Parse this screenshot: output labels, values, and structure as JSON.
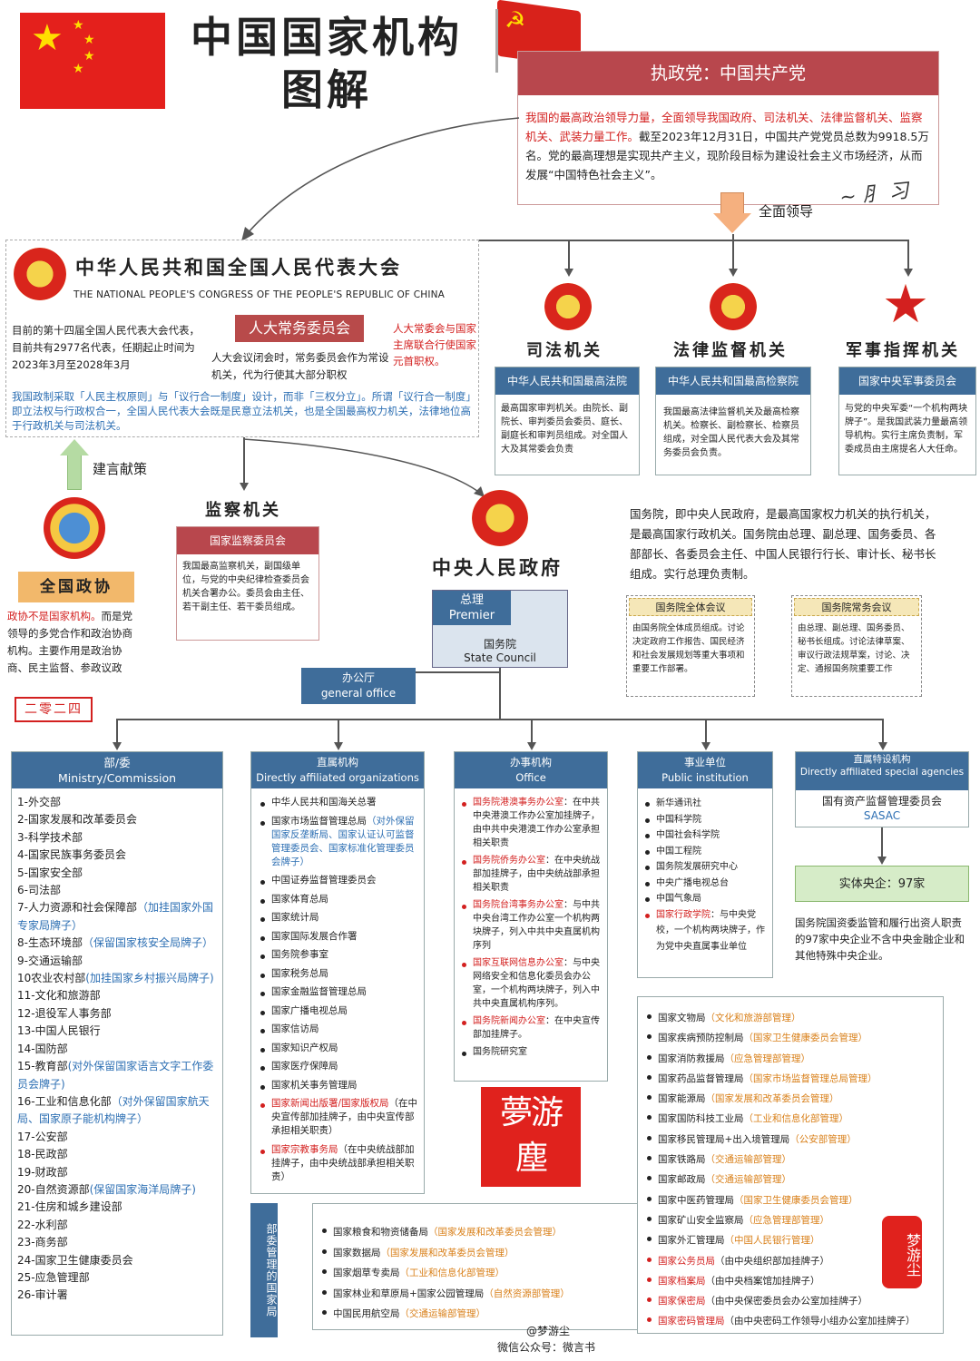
{
  "header": {
    "title_line1": "中国国家机构",
    "title_line2": "图解"
  },
  "party": {
    "title": "执政党：中国共产党",
    "desc_red": "我国的最高政治领导力量，全面领导我国政府、司法机关、法律监督机关、监察机关、武装力量工作。",
    "desc_black": "截至2023年12月31日，中国共产党党员总数为9918.5万名。党的最高理想是实现共产主义，现阶段目标为建设社会主义市场经济，从而发展“中国特色社会主义”。",
    "lead_label": "全面领导"
  },
  "npc": {
    "title_cn": "中华人民共和国全国人民代表大会",
    "title_en": "THE NATIONAL PEOPLE'S CONGRESS OF THE PEOPLE'S REPUBLIC OF CHINA",
    "info": "目前的第十四届全国人民代表大会代表，目前共有2977名代表，任期起止时间为2023年3月至2028年3月",
    "standing_title": "人大常务委员会",
    "standing_desc": "人大会议闭会时，常务委员会作为常设机关，代为行使其大部分职权",
    "standing_note": "人大常委会与国家主席联合行使国家元首职权。",
    "principle": "我国政制采取「人民主权原则」与「议行合一制度」设计，而非「三权分立」。所谓「议行合一制度」即立法权与行政权合一，全国人民代表大会既是民意立法机关，也是全国最高权力机关，法律地位高于行政机关与司法机关。"
  },
  "advise_label": "建言献策",
  "cppcc": {
    "title": "全国政协",
    "desc_red": "政协不是国家机构。",
    "desc_black": "而是党领导的多党合作和政治协商机构。主要作用是政治协商、民主监督、参政议政",
    "stamp": "二零二四"
  },
  "supervision": {
    "heading": "监察机关",
    "title": "国家监察委员会",
    "desc": "我国最高监察机关，副国级单位，与党的中央纪律检查委员会机关合署办公。委员会由主任、若干副主任、若干委员组成。"
  },
  "judicial": {
    "heading": "司法机关",
    "title": "中华人民共和国最高法院",
    "desc": "最高国家审判机关。由院长、副院长、审判委员会委员、庭长、副庭长和审判员组成。对全国人大及其常委会负责"
  },
  "procuratorate": {
    "heading": "法律监督机关",
    "title": "中华人民共和国最高检察院",
    "desc": "我国最高法律监督机关及最高检察机关。检察长、副检察长、检察员组成，对全国人民代表大会及其常务委员会负责。"
  },
  "military": {
    "heading": "军事指挥机关",
    "title": "国家中央军事委员会",
    "desc": "与党的中央军委“一个机构两块牌子”。是我国武装力量最高领导机构。实行主席负责制，军委成员由主席提名人大任命。"
  },
  "state_council": {
    "heading": "中央人民政府",
    "desc": "国务院，即中央人民政府，是最高国家权力机关的执行机关，是最高国家行政机关。国务院由总理、副总理、国务委员、各部部长、各委员会主任、中国人民银行行长、审计长、秘书长组成。实行总理负责制。",
    "premier_cn": "总理",
    "premier_en": "Premier",
    "council_cn": "国务院",
    "council_en": "State Council",
    "office_cn": "办公厅",
    "office_en": "general office",
    "plenary_title": "国务院全体会议",
    "plenary_desc": "由国务院全体成员组成。讨论决定政府工作报告、国民经济和社会发展规划等重大事项和重要工作部署。",
    "executive_title": "国务院常务会议",
    "executive_desc": "由总理、副总理、国务委员、秘书长组成。讨论法律草案、审议行政法规草案，讨论、决定、通报国务院重要工作"
  },
  "ministries": {
    "title_cn": "部/委",
    "title_en": "Ministry/Commission",
    "items": [
      {
        "text": "1-外交部",
        "note": ""
      },
      {
        "text": "2-国家发展和改革委员会",
        "note": ""
      },
      {
        "text": "3-科学技术部",
        "note": ""
      },
      {
        "text": "4-国家民族事务委员会",
        "note": ""
      },
      {
        "text": "5-国家安全部",
        "note": ""
      },
      {
        "text": "6-司法部",
        "note": ""
      },
      {
        "text": "7-人力资源和社会保障部",
        "note": "（加挂国家外国专家局牌子）"
      },
      {
        "text": "8-生态环境部",
        "note": "（保留国家核安全局牌子）"
      },
      {
        "text": "9-交通运输部",
        "note": ""
      },
      {
        "text": "10农业农村部",
        "note": "(加挂国家乡村振兴局牌子)"
      },
      {
        "text": "11-文化和旅游部",
        "note": ""
      },
      {
        "text": "12-退役军人事务部",
        "note": ""
      },
      {
        "text": "13-中国人民银行",
        "note": ""
      },
      {
        "text": "14-国防部",
        "note": ""
      },
      {
        "text": "15-教育部",
        "note": "(对外保留国家语言文字工作委员会牌子)"
      },
      {
        "text": "16-工业和信息化部",
        "note": "（对外保留国家航天局、国家原子能机构牌子）"
      },
      {
        "text": "17-公安部",
        "note": ""
      },
      {
        "text": "18-民政部",
        "note": ""
      },
      {
        "text": "19-财政部",
        "note": ""
      },
      {
        "text": "20-自然资源部",
        "note": "(保留国家海洋局牌子)"
      },
      {
        "text": "21-住房和城乡建设部",
        "note": ""
      },
      {
        "text": "22-水利部",
        "note": ""
      },
      {
        "text": "23-商务部",
        "note": ""
      },
      {
        "text": "24-国家卫生健康委员会",
        "note": ""
      },
      {
        "text": "25-应急管理部",
        "note": ""
      },
      {
        "text": "26-审计署",
        "note": ""
      }
    ]
  },
  "affiliated": {
    "title_cn": "直属机构",
    "title_en": "Directly affiliated organizations",
    "items": [
      {
        "text": "中华人民共和国海关总署",
        "note": "",
        "red": false
      },
      {
        "text": "国家市场监督管理总局",
        "note": "（对外保留国家反垄断局、国家认证认可监督管理委员会、国家标准化管理委员会牌子）",
        "red": false
      },
      {
        "text": "中国证券监督管理委员会",
        "note": "",
        "red": false
      },
      {
        "text": "国家体育总局",
        "note": "",
        "red": false
      },
      {
        "text": "国家统计局",
        "note": "",
        "red": false
      },
      {
        "text": "国家国际发展合作署",
        "note": "",
        "red": false
      },
      {
        "text": "国务院参事室",
        "note": "",
        "red": false
      },
      {
        "text": "国家税务总局",
        "note": "",
        "red": false
      },
      {
        "text": "国家金融监督管理总局",
        "note": "",
        "red": false
      },
      {
        "text": "国家广播电视总局",
        "note": "",
        "red": false
      },
      {
        "text": "国家信访局",
        "note": "",
        "red": false
      },
      {
        "text": "国家知识产权局",
        "note": "",
        "red": false
      },
      {
        "text": "国家医疗保障局",
        "note": "",
        "red": false
      },
      {
        "text": "国家机关事务管理局",
        "note": "",
        "red": false
      },
      {
        "text": "国家新闻出版署/国家版权局",
        "note": "（在中央宣传部加挂牌子，由中央宣传部承担相关职责）",
        "red": true
      },
      {
        "text": "国家宗教事务局",
        "note": "（在中央统战部加挂牌子，由中央统战部承担相关职责）",
        "red": true
      }
    ]
  },
  "offices": {
    "title_cn": "办事机构",
    "title_en": "Office",
    "items": [
      {
        "name": "国务院港澳事务办公室",
        "desc": "：在中共中央港澳工作办公室加挂牌子，由中共中央港澳工作办公室承担相关职责"
      },
      {
        "name": "国务院侨务办公室",
        "desc": "：在中央统战部加挂牌子，由中央统战部承担相关职责"
      },
      {
        "name": "国务院台湾事务办公室",
        "desc": "：与中共中央台湾工作办公室一个机构两块牌子，列入中共中央直属机构序列"
      },
      {
        "name": "国家互联网信息办公室",
        "desc": "：与中央网络安全和信息化委员会办公室，一个机构两块牌子，列入中共中央直属机构序列。"
      },
      {
        "name": "国务院新闻办公室",
        "desc": "：在中央宣传部加挂牌子。"
      },
      {
        "name": "国务院研究室",
        "desc": ""
      }
    ]
  },
  "institutions": {
    "title_cn": "事业单位",
    "title_en": "Public institution",
    "items": [
      {
        "text": "新华通讯社",
        "desc": "",
        "red": false
      },
      {
        "text": "中国科学院",
        "desc": "",
        "red": false
      },
      {
        "text": "中国社会科学院",
        "desc": "",
        "red": false
      },
      {
        "text": "中国工程院",
        "desc": "",
        "red": false
      },
      {
        "text": "国务院发展研究中心",
        "desc": "",
        "red": false
      },
      {
        "text": "中央广播电视总台",
        "desc": "",
        "red": false
      },
      {
        "text": "中国气象局",
        "desc": "",
        "red": false
      },
      {
        "text": "国家行政学院",
        "desc": "：与中央党校，一个机构两块牌子，作为党中央直属事业单位",
        "red": true
      }
    ]
  },
  "special": {
    "title_cn": "直属特设机构",
    "title_en": "Directly affiliated special agencies",
    "sasac_cn": "国有资产监督管理委员会",
    "sasac_en": "SASAC",
    "soe_title": "实体央企：97家",
    "soe_desc": "国务院国资委监管和履行出资人职责的97家中央企业不含中央金融企业和其他特殊中央企业。"
  },
  "managed_label": "部委管理的国家局",
  "bureaus_left": [
    {
      "text": "国家粮食和物资储备局",
      "note": "（国家发展和改革委员会管理）",
      "red": false
    },
    {
      "text": "国家数据局",
      "note": "（国家发展和改革委员会管理）",
      "red": false
    },
    {
      "text": "国家烟草专卖局",
      "note": "（工业和信息化部管理）",
      "red": false
    },
    {
      "text": "国家林业和草原局+国家公园管理局",
      "note": "（自然资源部管理）",
      "red": false
    },
    {
      "text": "中国民用航空局",
      "note": "（交通运输部管理）",
      "red": false
    }
  ],
  "bureaus_right": [
    {
      "text": "国家文物局",
      "note": "（文化和旅游部管理）",
      "red": false,
      "black": false
    },
    {
      "text": "国家疾病预防控制局",
      "note": "（国家卫生健康委员会管理）",
      "red": false,
      "black": false
    },
    {
      "text": "国家消防救援局",
      "note": "（应急管理部管理）",
      "red": false,
      "black": false
    },
    {
      "text": "国家药品监督管理局",
      "note": "（国家市场监督管理总局管理）",
      "red": false,
      "black": false
    },
    {
      "text": "国家能源局",
      "note": "（国家发展和改革委员会管理）",
      "red": false,
      "black": false
    },
    {
      "text": "国家国防科技工业局",
      "note": "（工业和信息化部管理）",
      "red": false,
      "black": false
    },
    {
      "text": "国家移民管理局+出入境管理局",
      "note": "（公安部管理）",
      "red": false,
      "black": false
    },
    {
      "text": "国家铁路局",
      "note": "（交通运输部管理）",
      "red": false,
      "black": false
    },
    {
      "text": "国家邮政局",
      "note": "（交通运输部管理）",
      "red": false,
      "black": false
    },
    {
      "text": "国家中医药管理局",
      "note": "（国家卫生健康委员会管理）",
      "red": false,
      "black": false
    },
    {
      "text": "国家矿山安全监察局",
      "note": "（应急管理部管理）",
      "red": false,
      "black": false
    },
    {
      "text": "国家外汇管理局",
      "note": "（中国人民银行管理）",
      "red": false,
      "black": false
    },
    {
      "text": "国家公务员局",
      "note": "（由中央组织部加挂牌子）",
      "red": true,
      "black": true
    },
    {
      "text": "国家档案局",
      "note": "（由中央档案馆加挂牌子）",
      "red": true,
      "black": true
    },
    {
      "text": "国家保密局",
      "note": "（由中央保密委员会办公室加挂牌子）",
      "red": true,
      "black": true
    },
    {
      "text": "国家密码管理局",
      "note": "（由中央密码工作领导小组办公室加挂牌子）",
      "red": true,
      "black": true
    }
  ],
  "seal_text": "夢游塵",
  "seal2_text": "梦游尘",
  "footer": {
    "author": "@梦游尘",
    "wechat": "微信公众号：微言书"
  },
  "colors": {
    "red": "#d3201f",
    "blue_header": "#3f6d9a",
    "party_header": "#b8474d",
    "npc_standing": "#b84a4a",
    "cppcc_label": "#f2b86b",
    "soe_green": "#d6ecc8"
  }
}
